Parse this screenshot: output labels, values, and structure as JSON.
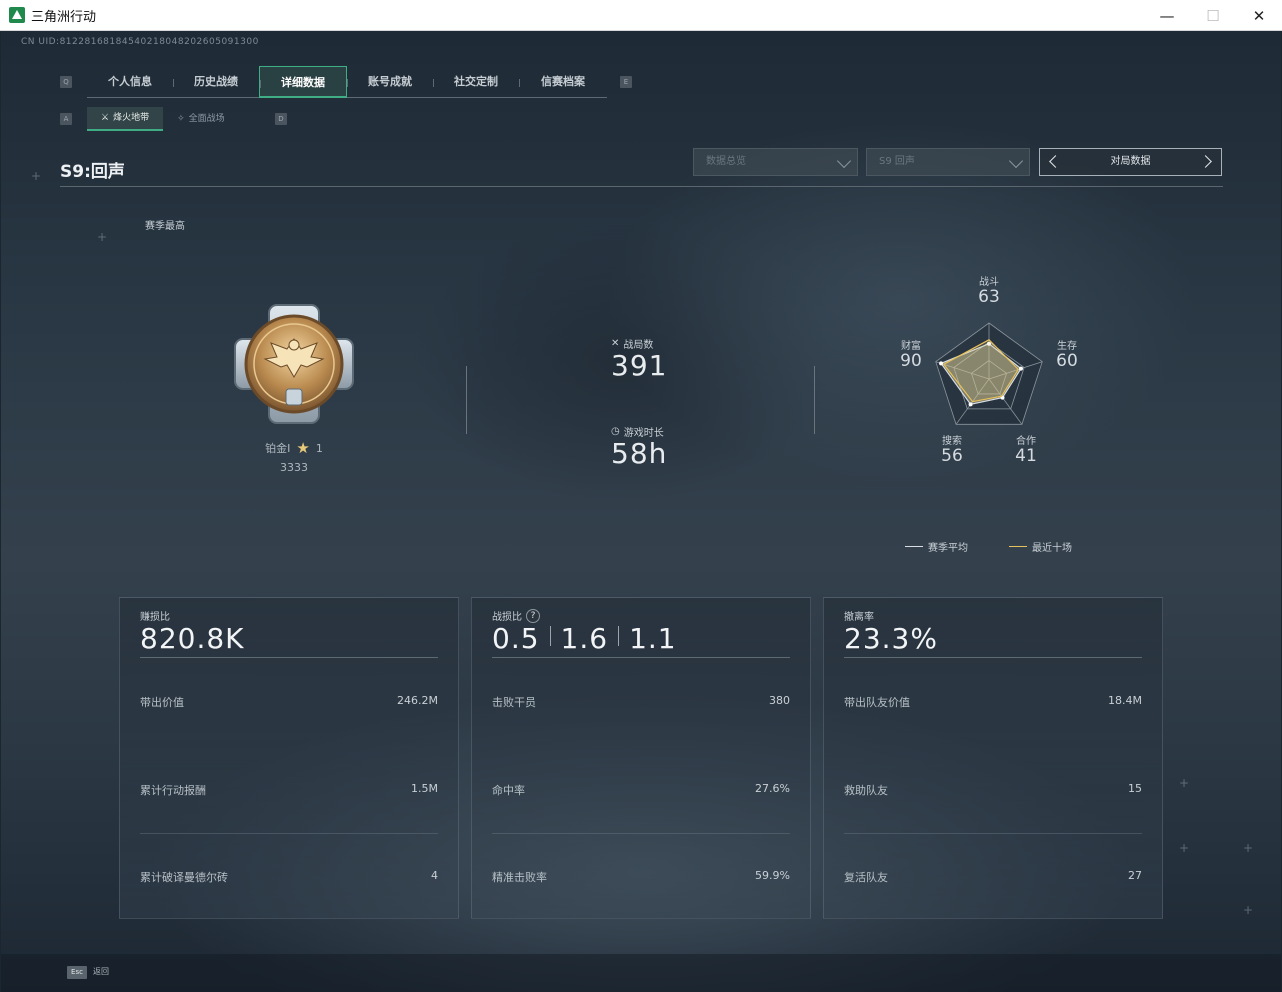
{
  "window": {
    "title": "三角洲行动",
    "minimize": "—",
    "maximize": "☐",
    "close": "✕"
  },
  "header": {
    "uid": "CN UID:812281681845402180482026050913​00",
    "key_left": "Q",
    "key_right": "E",
    "subkey_left": "A",
    "subkey_right": "D"
  },
  "tabs": [
    {
      "label": "个人信息"
    },
    {
      "label": "历史战绩"
    },
    {
      "label": "详细数据"
    },
    {
      "label": "账号成就"
    },
    {
      "label": "社交定制"
    },
    {
      "label": "信赛档案"
    }
  ],
  "subtabs": [
    {
      "label": "烽火地带"
    },
    {
      "label": "全面战场"
    }
  ],
  "season": {
    "title": "S9:回声",
    "best_label": "赛季最高"
  },
  "filters": {
    "data_overview": "数据总览",
    "season_select": "S9 回声",
    "pager_label": "对局数据"
  },
  "rank": {
    "name": "铂金Ⅰ",
    "stars": "1",
    "score": "3333",
    "medal_numeral": "I"
  },
  "summary": {
    "matches_label": "战局数",
    "matches_value": "391",
    "playtime_label": "游戏时长",
    "playtime_value": "58h"
  },
  "radar": {
    "axes": [
      {
        "label": "战斗",
        "value": "63"
      },
      {
        "label": "生存",
        "value": "60"
      },
      {
        "label": "合作",
        "value": "41"
      },
      {
        "label": "搜索",
        "value": "56"
      },
      {
        "label": "财富",
        "value": "90"
      }
    ],
    "series": [
      {
        "name": "赛季平均",
        "values": [
          63,
          60,
          41,
          56,
          90
        ],
        "color": "#d7dde2"
      },
      {
        "name": "最近十场",
        "values": [
          70,
          55,
          38,
          50,
          85
        ],
        "color": "#e8c15a"
      }
    ]
  },
  "cards": [
    {
      "title": "赚损比",
      "big": "820.8K",
      "rows": [
        {
          "k": "带出价值",
          "v": "246.2M"
        },
        {
          "k": "累计行动报酬",
          "v": "1.5M"
        },
        {
          "k": "累计破译曼德尔砖",
          "v": "4"
        }
      ]
    },
    {
      "title": "战损比",
      "help": "?",
      "big_parts": [
        "0.5",
        "1.6",
        "1.1"
      ],
      "rows": [
        {
          "k": "击败干员",
          "v": "380"
        },
        {
          "k": "命中率",
          "v": "27.6%"
        },
        {
          "k": "精准击败率",
          "v": "59.9%"
        }
      ]
    },
    {
      "title": "撤离率",
      "big": "23.3%",
      "rows": [
        {
          "k": "带出队友价值",
          "v": "18.4M"
        },
        {
          "k": "救助队友",
          "v": "15"
        },
        {
          "k": "复活队友",
          "v": "27"
        }
      ]
    }
  ],
  "footer": {
    "esc_key": "Esc",
    "esc_label": "返回"
  }
}
